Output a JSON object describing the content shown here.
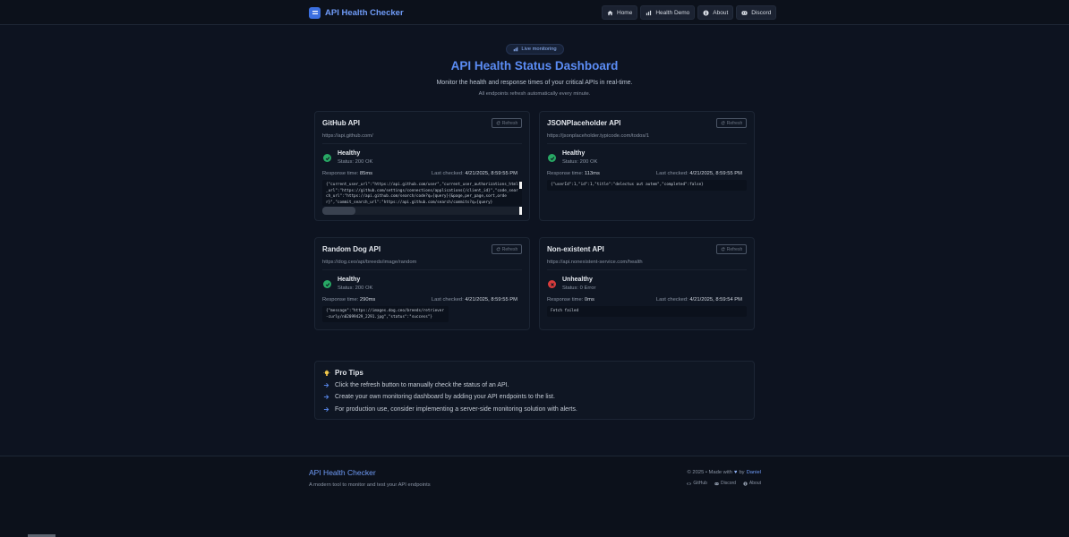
{
  "header": {
    "brand": "API Health Checker",
    "nav": [
      {
        "label": "Home",
        "icon": "home-icon"
      },
      {
        "label": "Health Demo",
        "icon": "bar-chart-icon"
      },
      {
        "label": "About",
        "icon": "info-icon"
      },
      {
        "label": "Discord",
        "icon": "discord-icon"
      }
    ]
  },
  "hero": {
    "badge": "Live monitoring",
    "title": "API Health Status Dashboard",
    "subtitle": "Monitor the health and response times of your critical APIs in real-time.",
    "note": "All endpoints refresh automatically every minute."
  },
  "cards": [
    {
      "title": "GitHub API",
      "refresh_label": "Refresh",
      "url": "https://api.github.com/",
      "status": "Healthy",
      "status_code": "Status: 200 OK",
      "response_time_label": "Response time:",
      "response_time": "85ms",
      "last_checked_label": "Last checked:",
      "last_checked": "4/21/2025, 8:59:55 PM",
      "response": "{\"current_user_url\":\"https://api.github.com/user\",\"current_user_authorizations_html_url\":\"https://github.com/settings/connections/applications{/client_id}\",\"code_search_url\":\"https://api.github.com/search/code?q={query}{&page,per_page,sort,order}\",\"commit_search_url\":\"https://api.github.com/search/commits?q={query}",
      "healthy": true
    },
    {
      "title": "JSONPlaceholder API",
      "refresh_label": "Refresh",
      "url": "https://jsonplaceholder.typicode.com/todos/1",
      "status": "Healthy",
      "status_code": "Status: 200 OK",
      "response_time_label": "Response time:",
      "response_time": "113ms",
      "last_checked_label": "Last checked:",
      "last_checked": "4/21/2025, 8:59:55 PM",
      "response": "{\"userId\":1,\"id\":1,\"title\":\"delectus aut autem\",\"completed\":false}",
      "healthy": true
    },
    {
      "title": "Random Dog API",
      "refresh_label": "Refresh",
      "url": "https://dog.ceo/api/breeds/image/random",
      "status": "Healthy",
      "status_code": "Status: 200 OK",
      "response_time_label": "Response time:",
      "response_time": "290ms",
      "last_checked_label": "Last checked:",
      "last_checked": "4/21/2025, 8:59:55 PM",
      "response": "{\"message\":\"https://images.dog.ceo/breeds/retriever-curly/n02099429_2291.jpg\",\"status\":\"success\"}",
      "healthy": true
    },
    {
      "title": "Non-existent API",
      "refresh_label": "Refresh",
      "url": "https://api.nonexistent-service.com/health",
      "status": "Unhealthy",
      "status_code": "Status: 0 Error",
      "response_time_label": "Response time:",
      "response_time": "0ms",
      "last_checked_label": "Last checked:",
      "last_checked": "4/21/2025, 8:59:54 PM",
      "response": "Fetch failed",
      "healthy": false
    }
  ],
  "tips": {
    "title": "Pro Tips",
    "items": [
      "Click the refresh button to manually check the status of an API.",
      "Create your own monitoring dashboard by adding your API endpoints to the list.",
      "For production use, consider implementing a server-side monitoring solution with alerts."
    ]
  },
  "footer": {
    "brand": "API Health Checker",
    "tagline": "A modern tool to monitor and test your API endpoints",
    "copyright_prefix": "© 2025 • Made with",
    "heart": "♥",
    "by": "by",
    "author": "Daniel",
    "links": [
      {
        "label": "GitHub",
        "icon": "code-icon"
      },
      {
        "label": "Discord",
        "icon": "discord-icon"
      },
      {
        "label": "About",
        "icon": "info-icon"
      }
    ]
  },
  "colors": {
    "accent": "#5b8cf4",
    "healthy": "#28a864",
    "unhealthy": "#d93c3c",
    "background": "#0d1320"
  }
}
